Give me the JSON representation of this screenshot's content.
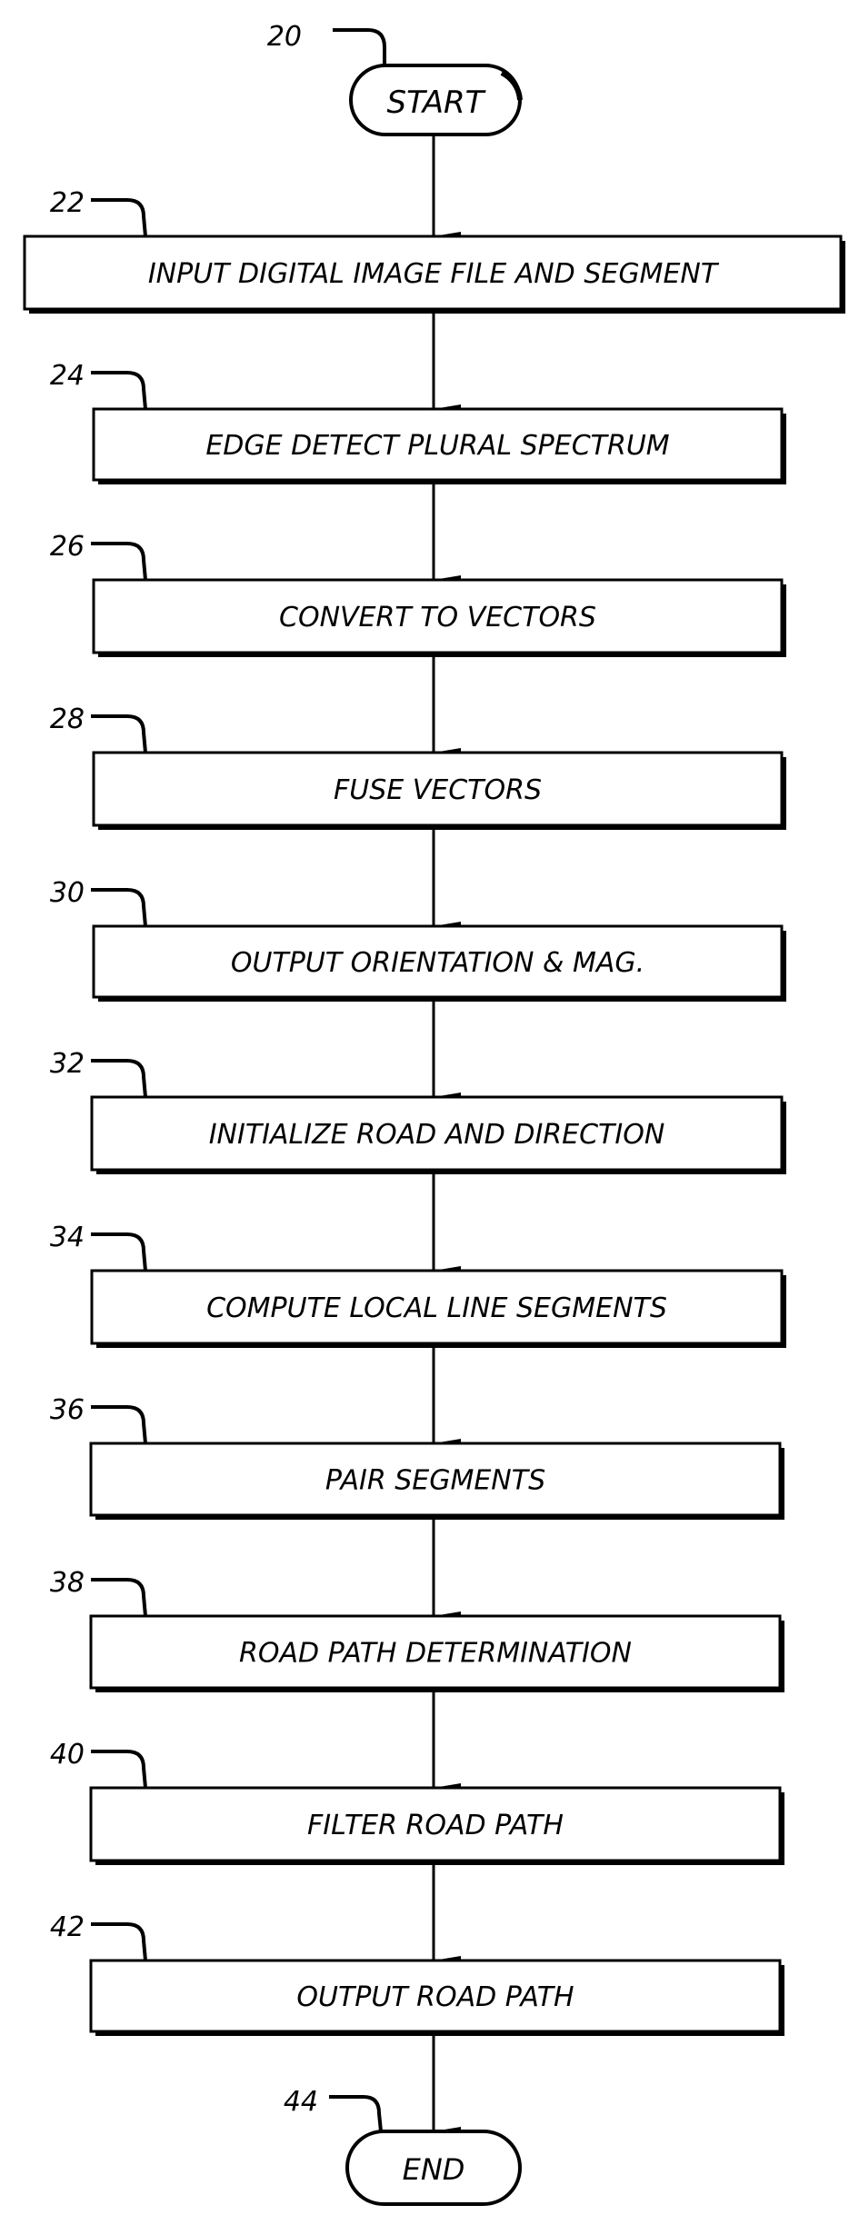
{
  "figure": {
    "start": {
      "ref": "20",
      "label": "START"
    },
    "end": {
      "ref": "44",
      "label": "END"
    },
    "steps": [
      {
        "ref": "22",
        "label": "INPUT DIGITAL IMAGE FILE AND SEGMENT"
      },
      {
        "ref": "24",
        "label": "EDGE DETECT PLURAL SPECTRUM"
      },
      {
        "ref": "26",
        "label": "CONVERT TO VECTORS"
      },
      {
        "ref": "28",
        "label": "FUSE VECTORS"
      },
      {
        "ref": "30",
        "label": "OUTPUT ORIENTATION & MAG."
      },
      {
        "ref": "32",
        "label": "INITIALIZE ROAD AND DIRECTION"
      },
      {
        "ref": "34",
        "label": "COMPUTE LOCAL LINE SEGMENTS"
      },
      {
        "ref": "36",
        "label": "PAIR SEGMENTS"
      },
      {
        "ref": "38",
        "label": "ROAD PATH DETERMINATION"
      },
      {
        "ref": "40",
        "label": "FILTER ROAD PATH"
      },
      {
        "ref": "42",
        "label": "OUTPUT ROAD PATH"
      }
    ]
  }
}
